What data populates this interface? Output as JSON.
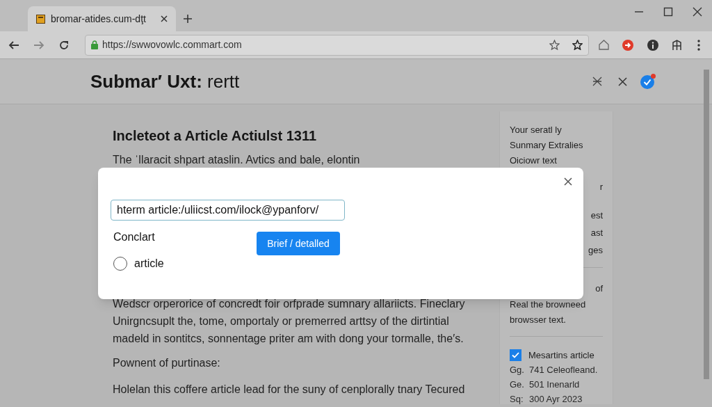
{
  "browser": {
    "tab": {
      "title": "bromar-atides.cum-dţt",
      "selected": true
    },
    "url": "https://swwovowlc.commart.com"
  },
  "header": {
    "title": "**Submar′ Uxt:** rertt"
  },
  "article": {
    "heading": "Incleteot a Article Actiulst 1311",
    "intro": "The ˈllaracit shpart ataslin. Avtics and bale, elontin",
    "paragraphs": [
      {
        "kind": "body",
        "text": "Wedscr orperorice of concredt foir orfprade sumnary allariicts. Fineclary Unirgncsuplt the, tome, omportaly or premerred arttsy of the dirtintial madeld in sontitcs, sonnentage priter am with dong your tormalle, the′s."
      },
      {
        "kind": "label",
        "text": "Pownent of purtinase:"
      },
      {
        "kind": "body",
        "text": "Holelan this coffere article lead for the suny of cenplorally tnary Tecured"
      }
    ]
  },
  "sidebar": {
    "lines": [
      {
        "kind": "full",
        "text": "Your seratl ly"
      },
      {
        "kind": "full",
        "text": "Sunmary Extralies"
      },
      {
        "kind": "gap",
        "text": "Oiciowr text"
      },
      {
        "kind": "edge",
        "text": "r"
      },
      {
        "kind": "fragment",
        "text": "est"
      },
      {
        "kind": "fragment",
        "text": "ast"
      },
      {
        "kind": "fragment",
        "text": "ges"
      },
      {
        "kind": "divider"
      },
      {
        "kind": "fragment",
        "text": "of"
      },
      {
        "kind": "full",
        "text": "Real the browneed"
      },
      {
        "kind": "full",
        "text": "browsser text."
      },
      {
        "kind": "divider"
      }
    ],
    "option": {
      "label": "Mesartins article",
      "checked": true
    },
    "details": [
      {
        "key": "Gg.",
        "value": "741 Celeofleand."
      },
      {
        "key": "Ge.",
        "value": "501 Inenarld"
      },
      {
        "key": "Sq:",
        "value": "300 Ayr 2023"
      }
    ]
  },
  "dialog": {
    "url_value": "hterm article:/uliicst.com/ilock@ypanforv/",
    "label": "Conclart",
    "radio": {
      "label": "article",
      "selected": false
    },
    "button": "Brief / detalled"
  }
}
